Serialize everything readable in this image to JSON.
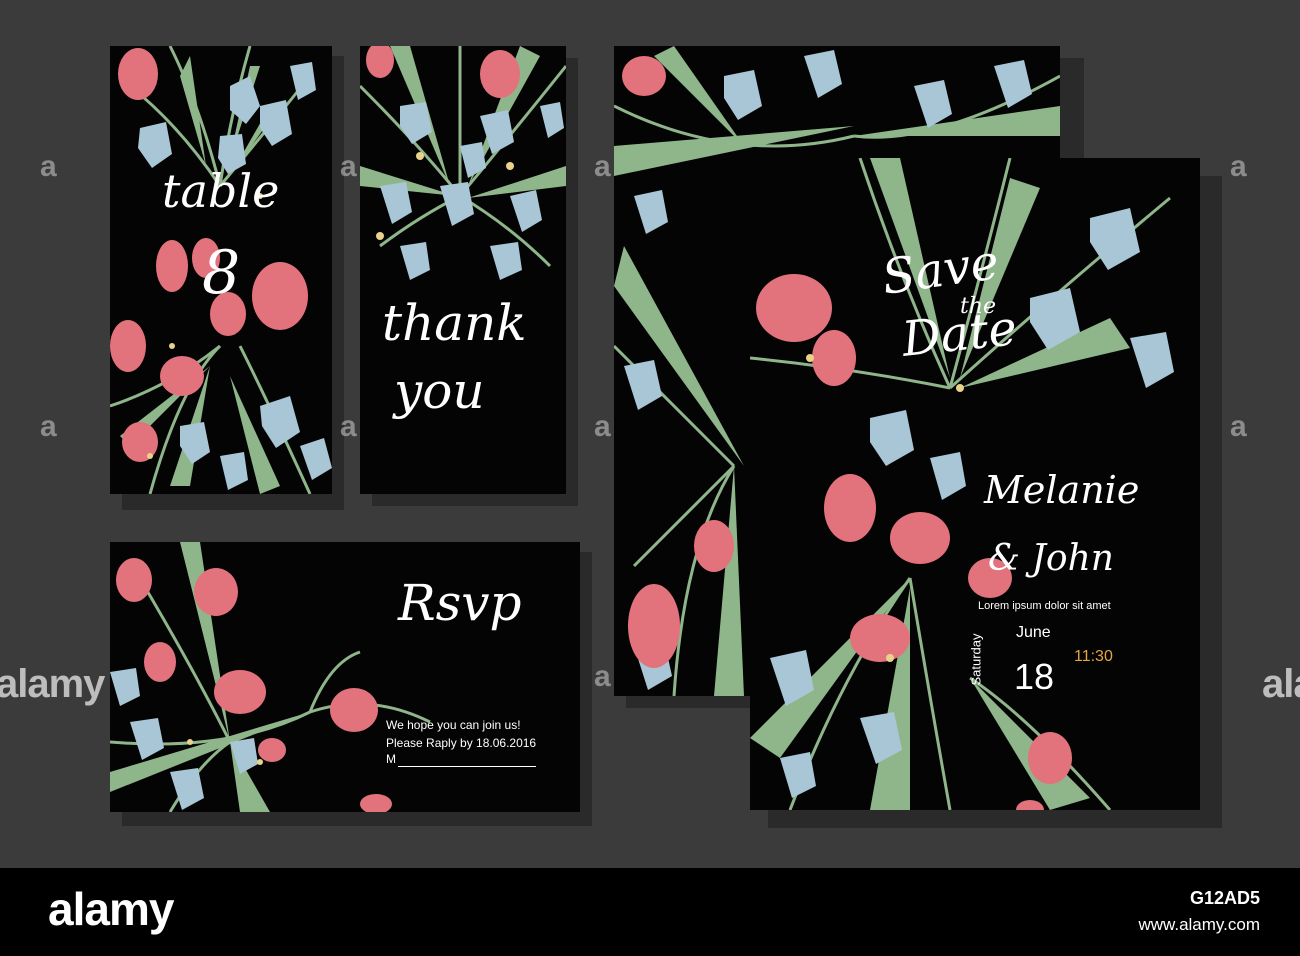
{
  "cards": {
    "table": {
      "word": "table",
      "number": "8"
    },
    "thank_you": {
      "line1": "thank",
      "line2": "you"
    },
    "rsvp": {
      "title": "Rsvp",
      "line1": "We hope you can join us!",
      "line2": "Please Raply by 18.06.2016",
      "line3": "M"
    },
    "save_the_date": {
      "save": "Save",
      "the": "the",
      "date": "Date",
      "name1": "Melanie",
      "name2": "& John",
      "lorem": "Lorem ipsum dolor sit amet",
      "weekday": "Saturday",
      "month": "June",
      "day": "18",
      "time": "11:30"
    }
  },
  "watermark": {
    "brand": "alamy",
    "side_mark": "alamy",
    "tile_letter": "a",
    "image_id": "G12AD5",
    "url": "www.alamy.com"
  },
  "colors": {
    "background": "#3b3b3b",
    "card": "#040404",
    "pink": "#e2727c",
    "blue": "#a9c6d6",
    "leaf": "#8fb58a",
    "accent_time": "#e4a63a"
  }
}
